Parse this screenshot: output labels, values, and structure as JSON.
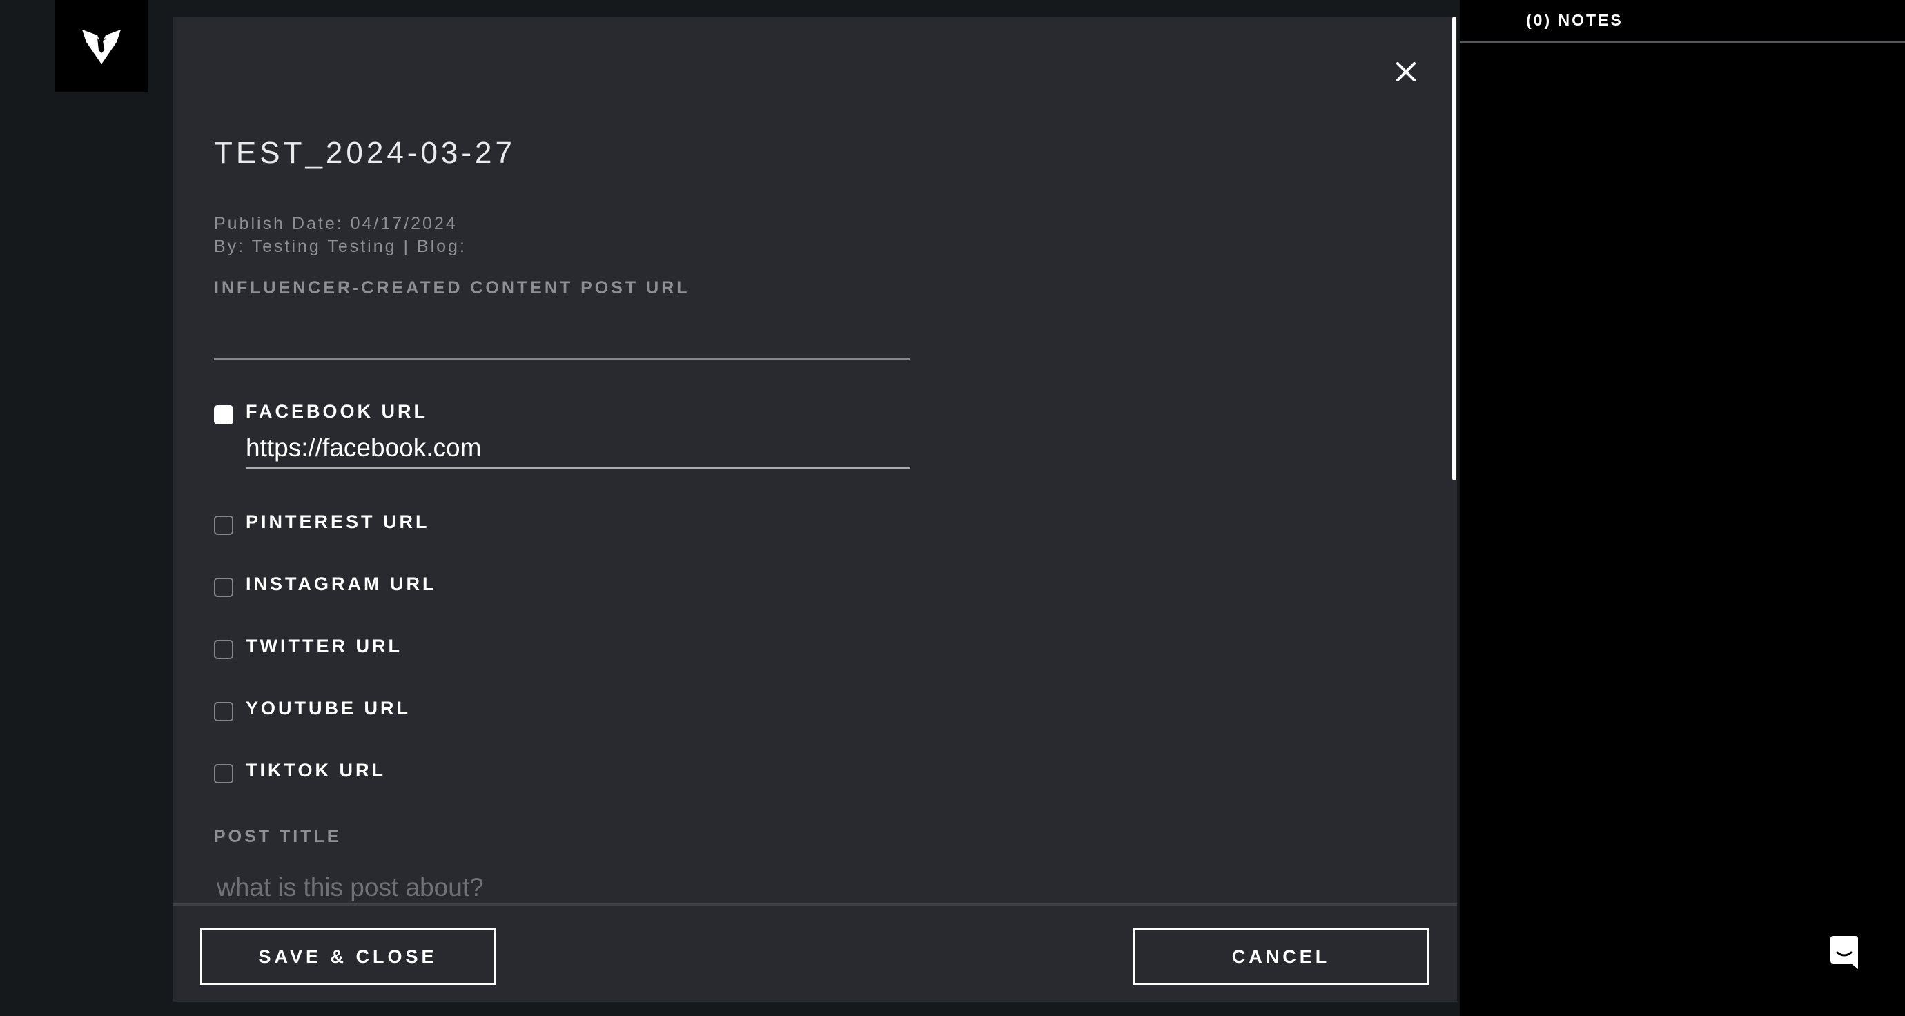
{
  "app": {
    "logo_icon": "brand-logo-icon"
  },
  "modal": {
    "title": "TEST_2024-03-27",
    "publish_date": "Publish Date: 04/17/2024",
    "byline": "By: Testing Testing | Blog:",
    "content_url_label": "INFLUENCER-CREATED CONTENT POST URL",
    "content_url_value": "",
    "close_icon": "close-icon",
    "social": [
      {
        "label": "FACEBOOK URL",
        "checked": true,
        "value": "https://facebook.com"
      },
      {
        "label": "PINTEREST URL",
        "checked": false
      },
      {
        "label": "INSTAGRAM URL",
        "checked": false
      },
      {
        "label": "TWITTER URL",
        "checked": false
      },
      {
        "label": "YOUTUBE URL",
        "checked": false
      },
      {
        "label": "TIKTOK URL",
        "checked": false
      }
    ],
    "post_title_label": "POST TITLE",
    "post_title_placeholder": "what is this post about?",
    "post_title_value": ""
  },
  "footer": {
    "save_label": "SAVE & CLOSE",
    "cancel_label": "CANCEL"
  },
  "notes": {
    "title": "(0) NOTES"
  },
  "chat": {
    "icon": "chat-icon"
  },
  "colors": {
    "page_bg": "#16191c",
    "modal_bg": "#282a2f",
    "text_primary": "#ffffff",
    "text_muted": "#8d8f94",
    "notes_bg": "#000000"
  }
}
